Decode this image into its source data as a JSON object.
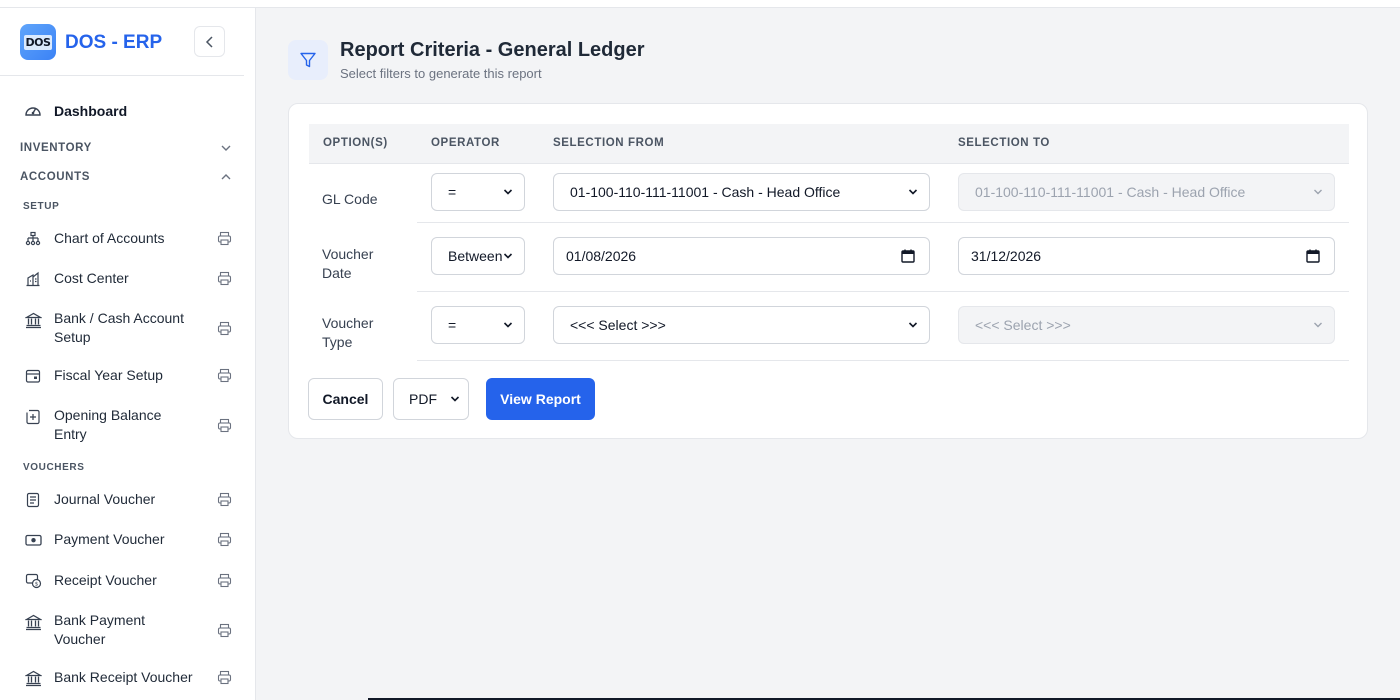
{
  "app": {
    "name": "DOS - ERP",
    "logo_text": "DOS"
  },
  "sidebar": {
    "dashboard": "Dashboard",
    "sections": {
      "inventory": "INVENTORY",
      "accounts": "ACCOUNTS"
    },
    "subsections": {
      "setup": "SETUP",
      "vouchers": "VOUCHERS"
    },
    "setup_items": [
      {
        "label": "Chart of Accounts",
        "icon": "sitemap-icon"
      },
      {
        "label": "Cost Center",
        "icon": "building-icon"
      },
      {
        "label": "Bank / Cash Account Setup",
        "icon": "bank-icon"
      },
      {
        "label": "Fiscal Year Setup",
        "icon": "calendar-icon"
      },
      {
        "label": "Opening Balance Entry",
        "icon": "plus-square-icon"
      }
    ],
    "voucher_items": [
      {
        "label": "Journal Voucher",
        "icon": "journal-icon"
      },
      {
        "label": "Payment Voucher",
        "icon": "cash-icon"
      },
      {
        "label": "Receipt Voucher",
        "icon": "receipt-icon"
      },
      {
        "label": "Bank Payment Voucher",
        "icon": "bank-icon"
      },
      {
        "label": "Bank Receipt Voucher",
        "icon": "bank-icon"
      }
    ]
  },
  "header": {
    "title": "Report Criteria - General Ledger",
    "subtitle": "Select filters to generate this report"
  },
  "table": {
    "columns": [
      "OPTION(S)",
      "OPERATOR",
      "SELECTION FROM",
      "SELECTION TO"
    ],
    "rows": [
      {
        "label": "GL Code",
        "operator": "=",
        "from": "01-100-110-111-11001 - Cash - Head Office",
        "to": "01-100-110-111-11001 - Cash - Head Office"
      },
      {
        "label": "Voucher Date",
        "operator": "Between",
        "from": "01/08/2026",
        "to": "31/12/2026"
      },
      {
        "label": "Voucher Type",
        "operator": "=",
        "from": "<<< Select >>>",
        "to": "<<< Select >>>"
      }
    ]
  },
  "actions": {
    "cancel": "Cancel",
    "format": "PDF",
    "view": "View Report"
  },
  "colors": {
    "primary": "#2563eb",
    "background": "#f3f4f6"
  }
}
